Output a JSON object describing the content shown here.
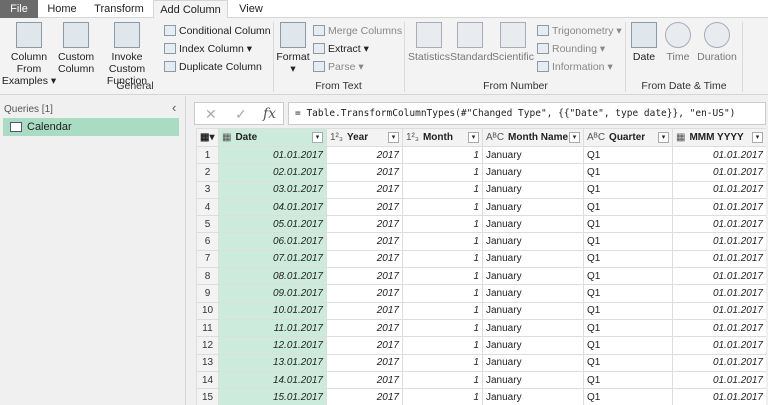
{
  "tabs": [
    "File",
    "Home",
    "Transform",
    "Add Column",
    "View"
  ],
  "ribbon": {
    "general": {
      "label": "General",
      "column_from_examples": "Column From",
      "column_from_examples2": "Examples ▾",
      "custom": "Custom",
      "custom2": "Column",
      "invoke": "Invoke Custom",
      "invoke2": "Function",
      "conditional": "Conditional Column",
      "index": "Index Column ▾",
      "duplicate": "Duplicate Column"
    },
    "from_text": {
      "label": "From Text",
      "format": "Format",
      "format2": "▾",
      "merge": "Merge Columns",
      "extract": "Extract ▾",
      "parse": "Parse ▾"
    },
    "from_number": {
      "label": "From Number",
      "statistics": "Statistics",
      "standard": "Standard",
      "scientific": "Scientific",
      "trig": "Trigonometry ▾",
      "rounding": "Rounding ▾",
      "information": "Information ▾"
    },
    "from_datetime": {
      "label": "From Date & Time",
      "date": "Date",
      "time": "Time",
      "duration": "Duration"
    }
  },
  "queries": {
    "header": "Queries [1]",
    "items": [
      "Calendar"
    ]
  },
  "formula": "= Table.TransformColumnTypes(#\"Changed Type\", {{\"Date\", type date}}, \"en-US\")",
  "columns": [
    {
      "type": "▦",
      "name": "Date"
    },
    {
      "type": "1²₃",
      "name": "Year"
    },
    {
      "type": "1²₃",
      "name": "Month"
    },
    {
      "type": "AᴮC",
      "name": "Month Name"
    },
    {
      "type": "AᴮC",
      "name": "Quarter"
    },
    {
      "type": "▦",
      "name": "MMM YYYY"
    }
  ],
  "rows": [
    [
      "01.01.2017",
      "2017",
      "1",
      "January",
      "Q1",
      "01.01.2017"
    ],
    [
      "02.01.2017",
      "2017",
      "1",
      "January",
      "Q1",
      "01.01.2017"
    ],
    [
      "03.01.2017",
      "2017",
      "1",
      "January",
      "Q1",
      "01.01.2017"
    ],
    [
      "04.01.2017",
      "2017",
      "1",
      "January",
      "Q1",
      "01.01.2017"
    ],
    [
      "05.01.2017",
      "2017",
      "1",
      "January",
      "Q1",
      "01.01.2017"
    ],
    [
      "06.01.2017",
      "2017",
      "1",
      "January",
      "Q1",
      "01.01.2017"
    ],
    [
      "07.01.2017",
      "2017",
      "1",
      "January",
      "Q1",
      "01.01.2017"
    ],
    [
      "08.01.2017",
      "2017",
      "1",
      "January",
      "Q1",
      "01.01.2017"
    ],
    [
      "09.01.2017",
      "2017",
      "1",
      "January",
      "Q1",
      "01.01.2017"
    ],
    [
      "10.01.2017",
      "2017",
      "1",
      "January",
      "Q1",
      "01.01.2017"
    ],
    [
      "11.01.2017",
      "2017",
      "1",
      "January",
      "Q1",
      "01.01.2017"
    ],
    [
      "12.01.2017",
      "2017",
      "1",
      "January",
      "Q1",
      "01.01.2017"
    ],
    [
      "13.01.2017",
      "2017",
      "1",
      "January",
      "Q1",
      "01.01.2017"
    ],
    [
      "14.01.2017",
      "2017",
      "1",
      "January",
      "Q1",
      "01.01.2017"
    ],
    [
      "15.01.2017",
      "2017",
      "1",
      "January",
      "Q1",
      "01.01.2017"
    ]
  ]
}
